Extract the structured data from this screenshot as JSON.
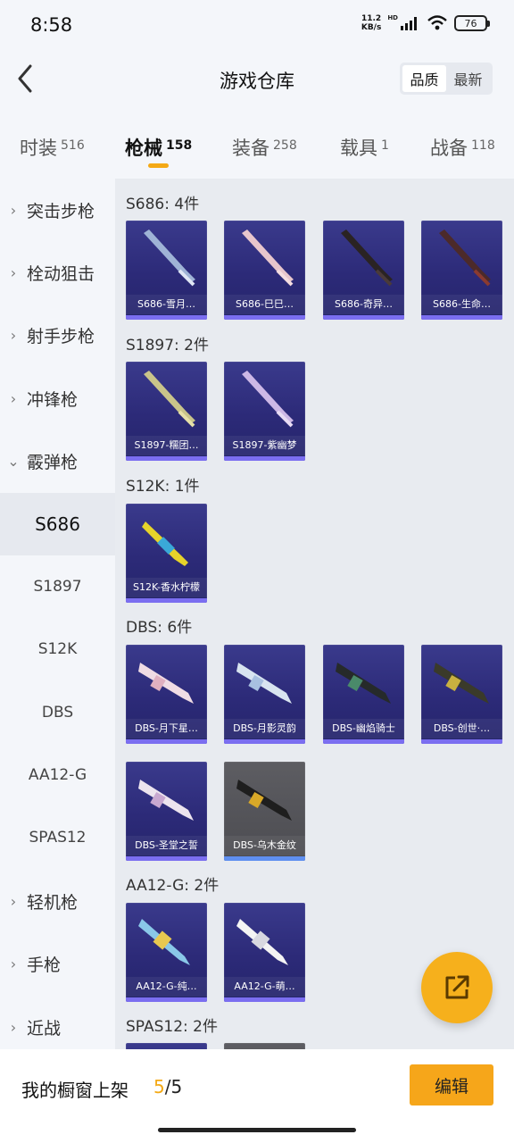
{
  "status": {
    "time": "8:58",
    "net_speed": "11.2",
    "net_unit": "KB/s",
    "hd": "HD",
    "battery": "76"
  },
  "header": {
    "title": "游戏仓库",
    "sort_options": [
      "品质",
      "最新"
    ],
    "sort_selected": "品质"
  },
  "tabs": [
    {
      "label": "时装",
      "count": "516"
    },
    {
      "label": "枪械",
      "count": "158",
      "active": true
    },
    {
      "label": "装备",
      "count": "258"
    },
    {
      "label": "载具",
      "count": "1"
    },
    {
      "label": "战备",
      "count": "118"
    }
  ],
  "sidebar": {
    "categories": [
      "突击步枪",
      "栓动狙击",
      "射手步枪",
      "冲锋枪",
      "霰弹枪",
      "轻机枪",
      "手枪",
      "近战"
    ],
    "subitems": [
      "S686",
      "S1897",
      "S12K",
      "DBS",
      "AA12-G",
      "SPAS12"
    ],
    "active_sub": "S686"
  },
  "groups": [
    {
      "title": "S686: 4件",
      "items": [
        "S686-雪月…",
        "S686-巳巳…",
        "S686-奇异…",
        "S686-生命…"
      ]
    },
    {
      "title": "S1897: 2件",
      "items": [
        "S1897-糯团…",
        "S1897-紫幽梦"
      ]
    },
    {
      "title": "S12K: 1件",
      "items": [
        "S12K-香水柠檬"
      ]
    },
    {
      "title": "DBS: 6件",
      "items": [
        "DBS-月下星…",
        "DBS-月影灵韵",
        "DBS-幽焰骑士",
        "DBS-创世·…",
        "DBS-圣堂之誓",
        "DBS-乌木金纹"
      ]
    },
    {
      "title": "AA12-G: 2件",
      "items": [
        "AA12-G-纯…",
        "AA12-G-萌…"
      ]
    },
    {
      "title": "SPAS12: 2件",
      "items": []
    }
  ],
  "footer": {
    "label": "我的橱窗上架",
    "current": "5",
    "total": "/5",
    "edit_label": "编辑"
  },
  "colors": {
    "accent": "#f4a915",
    "card_bg": "#2c2a78",
    "card_stripe": "#7b6ef0"
  }
}
